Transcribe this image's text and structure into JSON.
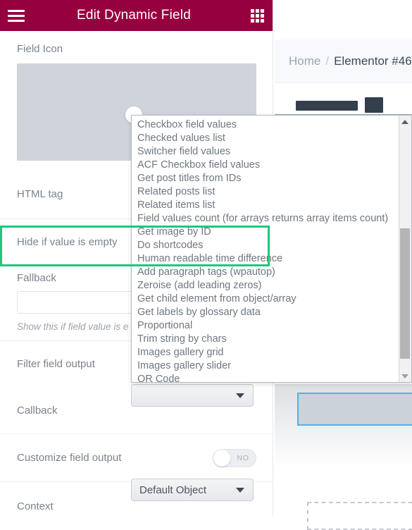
{
  "colors": {
    "header_bg": "#96003f",
    "highlight_green": "#1ec77c",
    "selection_blue": "#4fb4e8",
    "label_gray": "#7b838c"
  },
  "preview": {
    "breadcrumb": {
      "home_label": "Home",
      "separator": "/",
      "current_label": "Elementor #46"
    }
  },
  "panel": {
    "header": {
      "title": "Edit Dynamic Field",
      "menu_icon": "hamburger-icon",
      "apps_icon": "grid-icon"
    },
    "fields": {
      "field_icon_label": "Field Icon",
      "html_tag_label": "HTML tag",
      "hide_if_empty_label": "Hide if value is empty",
      "fallback_label": "Fallback",
      "fallback_value": "",
      "fallback_placeholder": "",
      "fallback_hint": "Show this if field value is e",
      "filter_field_output_label": "Filter field output",
      "callback_label": "Callback",
      "callback_value": "",
      "customize_field_output_label": "Customize field output",
      "customize_field_output_state": "NO",
      "context_label": "Context",
      "context_value": "Default Object"
    }
  },
  "dropdown": {
    "options": [
      "Checkbox field values",
      "Checked values list",
      "Switcher field values",
      "ACF Checkbox field values",
      "Get post titles from IDs",
      "Related posts list",
      "Related items list",
      "Field values count (for arrays returns array items count)",
      "Get image by ID",
      "Do shortcodes",
      "Human readable time difference",
      "Add paragraph tags (wpautop)",
      "Zeroise (add leading zeros)",
      "Get child element from object/array",
      "Get labels by glossary data",
      "Proportional",
      "Trim string by chars",
      "Images gallery grid",
      "Images gallery slider",
      "QR Code"
    ],
    "highlighted_options": [
      "Images gallery grid",
      "Images gallery slider",
      "QR Code"
    ],
    "scroll_up_icon": "triangle-up-icon",
    "scroll_down_icon": "triangle-down-icon"
  }
}
